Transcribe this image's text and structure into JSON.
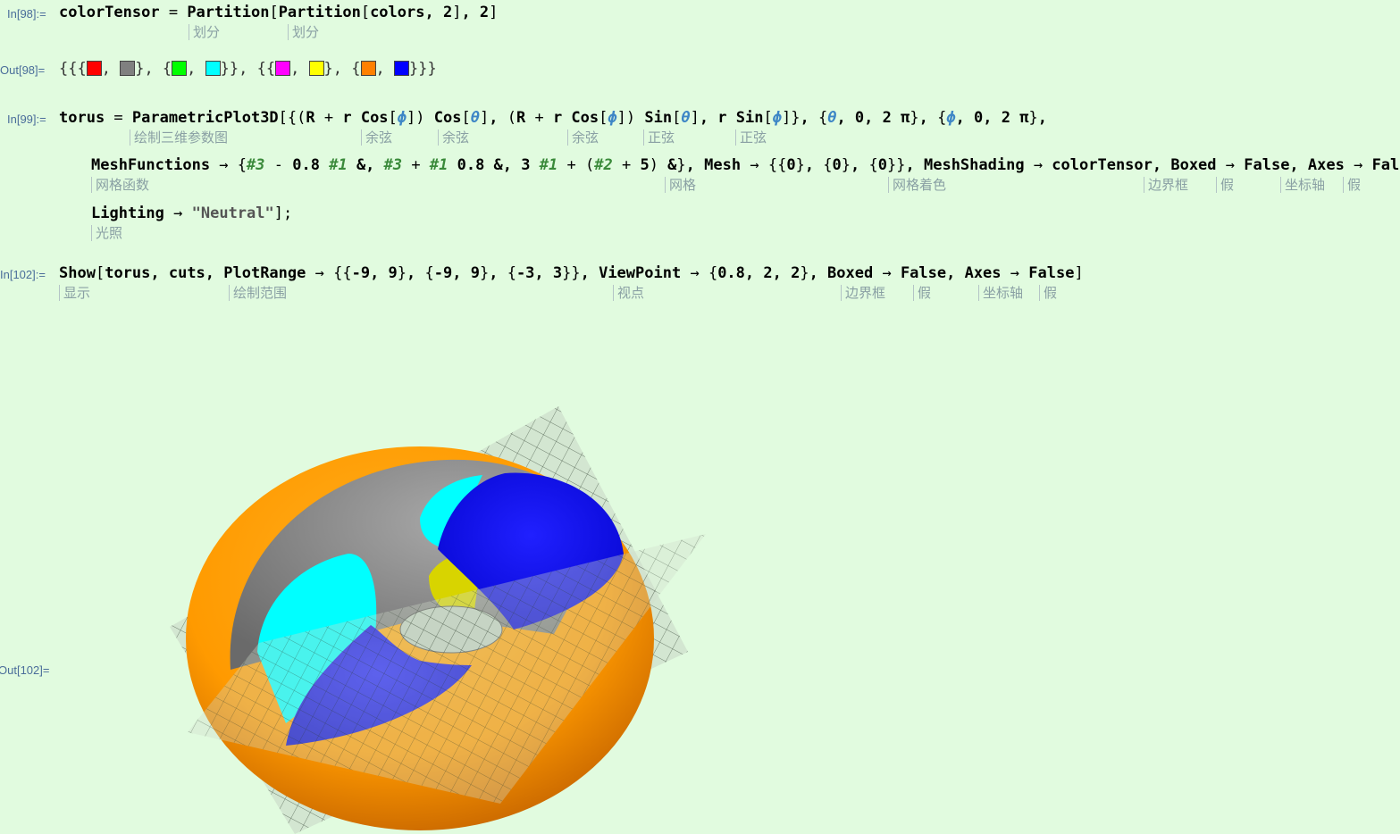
{
  "cells": {
    "in98_label": "In[98]:=",
    "out98_label": "Out[98]=",
    "in99_label": "In[99]:=",
    "in102_label": "In[102]:=",
    "out102_label": "Out[102]="
  },
  "in98": {
    "hints": [
      "划分",
      "划分"
    ]
  },
  "out98": {
    "colors": [
      "#ff0000",
      "#808080",
      "#00ff00",
      "#00ffff",
      "#ff00ff",
      "#ffff00",
      "#ff8000",
      "#0000ff"
    ]
  },
  "in99": {
    "hints_line1": [
      "绘制三维参数图",
      "余弦",
      "余弦",
      "余弦",
      "正弦",
      "正弦"
    ],
    "hints_line2": [
      "网格函数",
      "网格",
      "网格着色",
      "边界框",
      "假",
      "坐标轴",
      "假"
    ],
    "hints_line3": [
      "光照"
    ]
  },
  "in102": {
    "hints": [
      "显示",
      "绘制范围",
      "视点",
      "边界框",
      "假",
      "坐标轴",
      "假"
    ]
  },
  "plot_colors": {
    "gray": "#8c8c8c",
    "cyan": "#00ffff",
    "blue": "#0000ff",
    "orange": "#ff9a00",
    "yellow": "#d8d400"
  }
}
